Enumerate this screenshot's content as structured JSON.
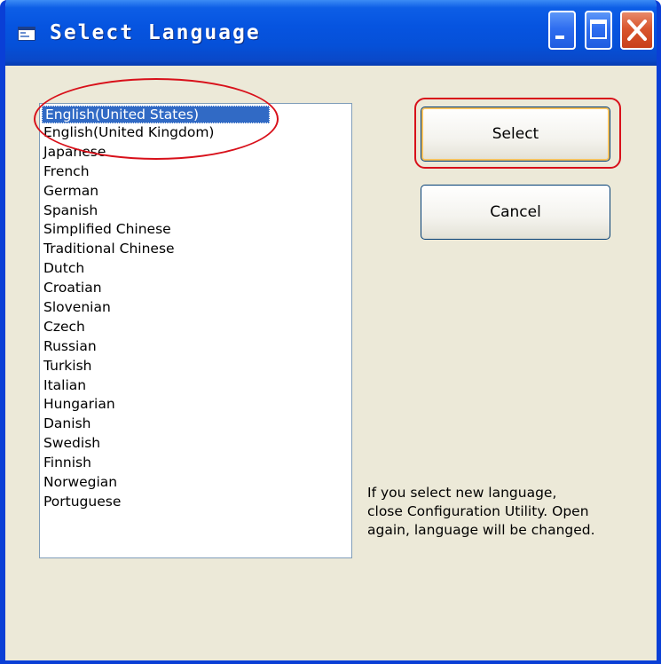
{
  "window": {
    "title": "Select Language",
    "icons": {
      "app": "window-app-icon",
      "minimize": "minimize-icon",
      "maximize": "maximize-icon",
      "close": "close-icon"
    }
  },
  "language_list": {
    "selected_index": 0,
    "items": [
      "English(United States)",
      "English(United Kingdom)",
      "Japanese",
      "French",
      "German",
      "Spanish",
      "Simplified Chinese",
      "Traditional Chinese",
      "Dutch",
      "Croatian",
      "Slovenian",
      "Czech",
      "Russian",
      "Turkish",
      "Italian",
      "Hungarian",
      "Danish",
      "Swedish",
      "Finnish",
      "Norwegian",
      "Portuguese"
    ]
  },
  "buttons": {
    "select": "Select",
    "cancel": "Cancel"
  },
  "note": {
    "lines": [
      "If you select new language,",
      "close Configuration Utility. Open",
      "again, language will be changed."
    ]
  },
  "colors": {
    "titlebar": "#0654e0",
    "selection": "#316ac5",
    "annotation": "#d8101a",
    "window_bg": "#ece9d8"
  }
}
